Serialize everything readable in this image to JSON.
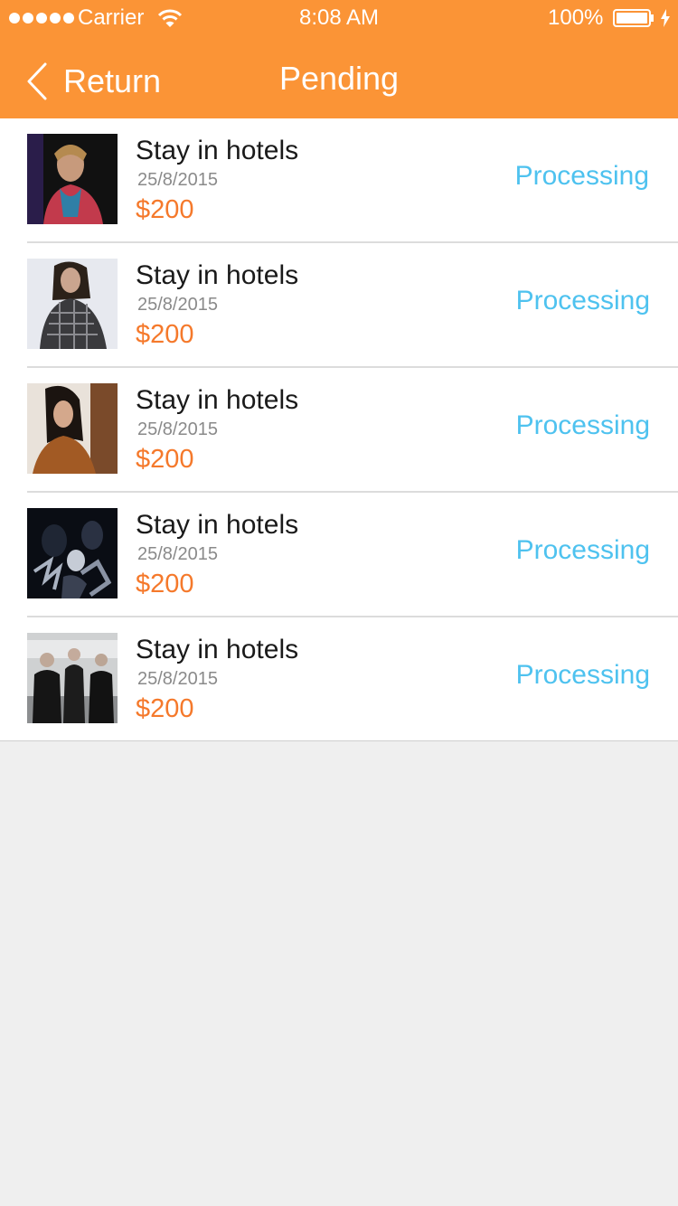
{
  "status_bar": {
    "carrier": "Carrier",
    "time": "8:08 AM",
    "battery": "100%"
  },
  "nav": {
    "back_label": "Return",
    "title": "Pending"
  },
  "colors": {
    "accent": "#fb9436",
    "price": "#f5792b",
    "status": "#4ec2ef",
    "background": "#efefef"
  },
  "items": [
    {
      "title": "Stay in hotels",
      "date": "25/8/2015",
      "price": "$200",
      "status": "Processing"
    },
    {
      "title": "Stay in hotels",
      "date": "25/8/2015",
      "price": "$200",
      "status": "Processing"
    },
    {
      "title": "Stay in hotels",
      "date": "25/8/2015",
      "price": "$200",
      "status": "Processing"
    },
    {
      "title": "Stay in hotels",
      "date": "25/8/2015",
      "price": "$200",
      "status": "Processing"
    },
    {
      "title": "Stay in hotels",
      "date": "25/8/2015",
      "price": "$200",
      "status": "Processing"
    }
  ]
}
